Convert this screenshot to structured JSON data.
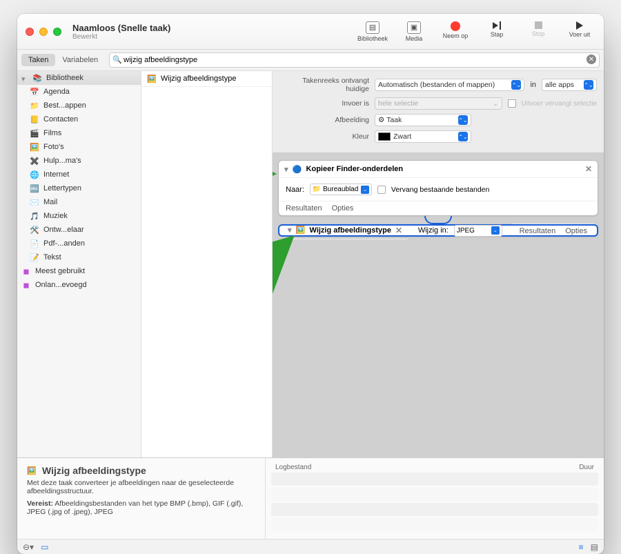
{
  "window": {
    "title": "Naamloos (Snelle taak)",
    "subtitle": "Bewerkt"
  },
  "toolbar": {
    "library": "Bibliotheek",
    "media": "Media",
    "record": "Neem op",
    "step": "Stap",
    "stop": "Stop",
    "run": "Voer uit"
  },
  "tabs": {
    "tasks": "Taken",
    "variables": "Variabelen"
  },
  "search": {
    "value": "wijzig afbeeldingstype",
    "placeholder": ""
  },
  "library": {
    "header": "Bibliotheek",
    "items": [
      "Agenda",
      "Best...appen",
      "Contacten",
      "Films",
      "Foto's",
      "Hulp...ma's",
      "Internet",
      "Lettertypen",
      "Mail",
      "Muziek",
      "Ontw...elaar",
      "Pdf-...anden",
      "Tekst"
    ],
    "recent": "Meest gebruikt",
    "recently_added": "Onlan...evoegd"
  },
  "mid": {
    "item": "Wijzig afbeeldingstype"
  },
  "header": {
    "row1_label": "Takenreeks ontvangt huidige",
    "row1_sel": "Automatisch (bestanden of mappen)",
    "row1_in": "in",
    "row1_apps": "alle apps",
    "row2_label": "Invoer is",
    "row2_sel": "hele selectie",
    "row2_chk": "Uitvoer vervangt selectie",
    "row3_label": "Afbeelding",
    "row3_sel": "Taak",
    "row4_label": "Kleur",
    "row4_sel": "Zwart"
  },
  "action1": {
    "title": "Kopieer Finder-onderdelen",
    "to_label": "Naar:",
    "to_value": "Bureaublad",
    "replace": "Vervang bestaande bestanden",
    "results": "Resultaten",
    "options": "Opties"
  },
  "action2": {
    "title": "Wijzig afbeeldingstype",
    "change_label": "Wijzig in:",
    "change_value": "JPEG",
    "results": "Resultaten",
    "options": "Opties"
  },
  "log": {
    "col1": "Logbestand",
    "col2": "Duur"
  },
  "desc": {
    "title": "Wijzig afbeeldingstype",
    "body": "Met deze taak converteer je afbeeldingen naar de geselecteerde afbeeldingsstructuur.",
    "req_label": "Vereist:",
    "req_body": "Afbeeldingsbestanden van het type BMP (.bmp), GIF (.gif), JPEG (.jpg of .jpeg), JPEG"
  }
}
